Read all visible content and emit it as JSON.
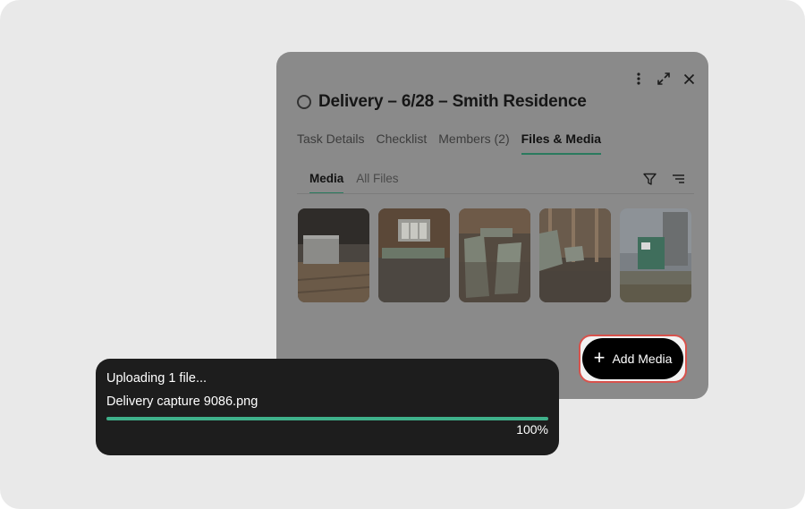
{
  "task": {
    "title": "Delivery – 6/28 – Smith Residence"
  },
  "tabs": [
    {
      "label": "Task Details"
    },
    {
      "label": "Checklist"
    },
    {
      "label": "Members (2)"
    },
    {
      "label": "Files & Media",
      "active": true
    }
  ],
  "subtabs": [
    {
      "label": "Media",
      "active": true
    },
    {
      "label": "All Files"
    }
  ],
  "actions": {
    "more_icon": "more-vertical-icon",
    "expand_icon": "expand-icon",
    "close_icon": "close-icon",
    "filter_icon": "filter-icon",
    "sort_icon": "sort-icon"
  },
  "media": [
    {
      "subject": "drywall stack on subfloor"
    },
    {
      "subject": "framed room with windows"
    },
    {
      "subject": "drywall sheets in corridor"
    },
    {
      "subject": "drywall leaning on framing"
    },
    {
      "subject": "exterior with dumpster"
    }
  ],
  "add_media": {
    "label": "Add Media",
    "icon": "plus-icon"
  },
  "upload": {
    "title": "Uploading 1 file...",
    "filename": "Delivery capture 9086.png",
    "progress_label": "100%",
    "progress": 1.0,
    "accent": "#3fb08a"
  }
}
